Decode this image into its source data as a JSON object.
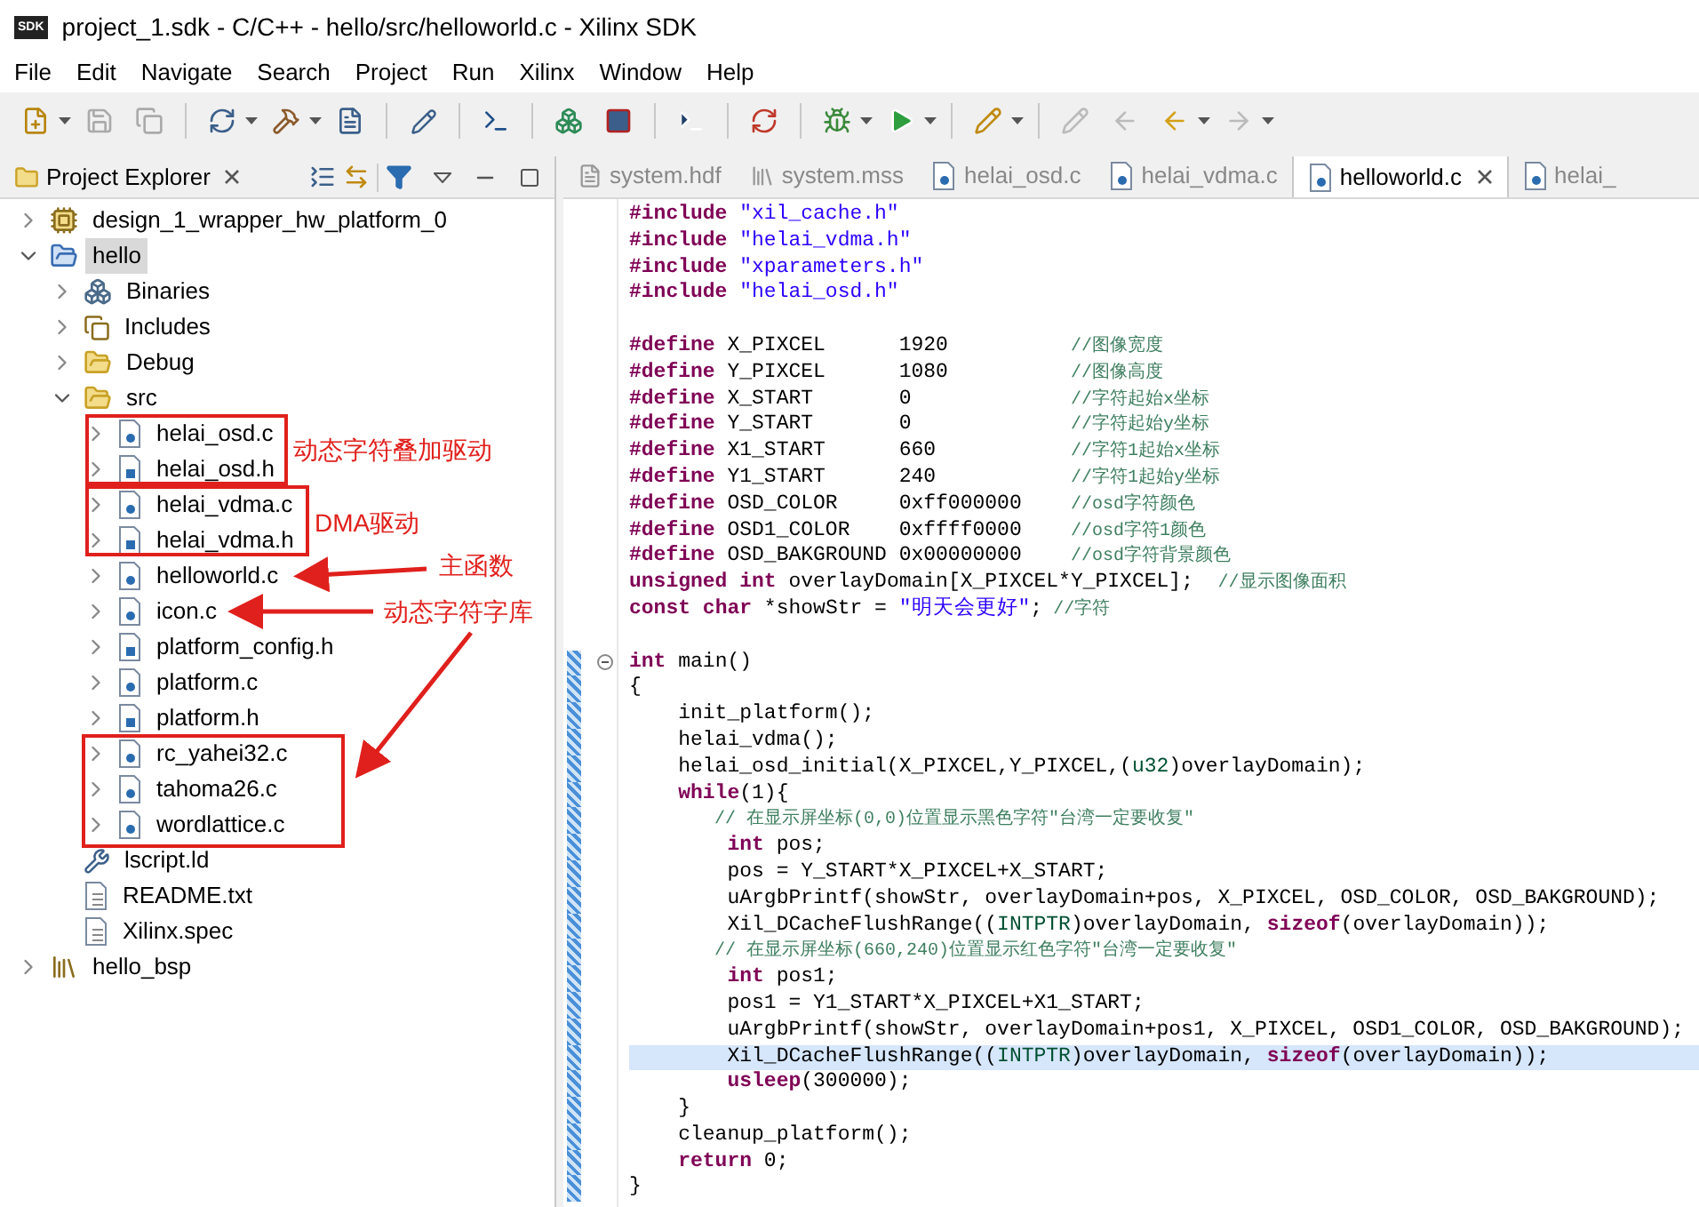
{
  "window": {
    "app_icon_text": "SDK",
    "title": "project_1.sdk - C/C++ - hello/src/helloworld.c - Xilinx SDK"
  },
  "menu": [
    "File",
    "Edit",
    "Navigate",
    "Search",
    "Project",
    "Run",
    "Xilinx",
    "Window",
    "Help"
  ],
  "project_explorer": {
    "title": "Project Explorer",
    "items": [
      {
        "label": "design_1_wrapper_hw_platform_0",
        "kind": "hw",
        "expanded": false,
        "selected": false
      },
      {
        "label": "hello",
        "kind": "project",
        "expanded": true,
        "selected": true,
        "children": [
          {
            "label": "Binaries",
            "kind": "binaries",
            "expanded": false,
            "selected": false
          },
          {
            "label": "Includes",
            "kind": "includes",
            "expanded": false,
            "selected": false
          },
          {
            "label": "Debug",
            "kind": "folder",
            "expanded": false,
            "selected": false
          },
          {
            "label": "src",
            "kind": "folder",
            "expanded": true,
            "selected": false,
            "children": [
              {
                "label": "helai_osd.c",
                "kind": "c",
                "expanded": false,
                "selected": false
              },
              {
                "label": "helai_osd.h",
                "kind": "h",
                "expanded": false,
                "selected": false
              },
              {
                "label": "helai_vdma.c",
                "kind": "c",
                "expanded": false,
                "selected": false
              },
              {
                "label": "helai_vdma.h",
                "kind": "h",
                "expanded": false,
                "selected": false
              },
              {
                "label": "helloworld.c",
                "kind": "c",
                "expanded": false,
                "selected": false
              },
              {
                "label": "icon.c",
                "kind": "c",
                "expanded": false,
                "selected": false
              },
              {
                "label": "platform_config.h",
                "kind": "h",
                "expanded": false,
                "selected": false
              },
              {
                "label": "platform.c",
                "kind": "c",
                "expanded": false,
                "selected": false
              },
              {
                "label": "platform.h",
                "kind": "h",
                "expanded": false,
                "selected": false
              },
              {
                "label": "rc_yahei32.c",
                "kind": "c",
                "expanded": false,
                "selected": false
              },
              {
                "label": "tahoma26.c",
                "kind": "c",
                "expanded": false,
                "selected": false
              },
              {
                "label": "wordlattice.c",
                "kind": "c",
                "expanded": false,
                "selected": false
              }
            ]
          },
          {
            "label": "lscript.ld",
            "kind": "ld",
            "selected": false
          },
          {
            "label": "README.txt",
            "kind": "txt",
            "selected": false
          },
          {
            "label": "Xilinx.spec",
            "kind": "txt",
            "selected": false
          }
        ]
      },
      {
        "label": "hello_bsp",
        "kind": "bsp",
        "expanded": false,
        "selected": false
      }
    ]
  },
  "annotations": [
    {
      "text": "动态字符叠加驱动"
    },
    {
      "text": "DMA驱动"
    },
    {
      "text": "主函数"
    },
    {
      "text": "动态字符字库"
    }
  ],
  "editor_tabs": [
    {
      "label": "system.hdf",
      "kind": "hdf",
      "selected": false
    },
    {
      "label": "system.mss",
      "kind": "mss",
      "selected": false
    },
    {
      "label": "helai_osd.c",
      "kind": "c",
      "selected": false
    },
    {
      "label": "helai_vdma.c",
      "kind": "c",
      "selected": false
    },
    {
      "label": "helloworld.c",
      "kind": "c",
      "selected": true
    },
    {
      "label": "helai_",
      "kind": "c",
      "selected": false
    }
  ],
  "code_lines": [
    {
      "changed": false,
      "current": false,
      "tokens": [
        {
          "kind": "keyword",
          "text": "#include"
        },
        {
          "kind": "string",
          "text": " \"xil_cache.h\""
        }
      ]
    },
    {
      "changed": false,
      "current": false,
      "tokens": [
        {
          "kind": "keyword",
          "text": "#include"
        },
        {
          "kind": "string",
          "text": " \"helai_vdma.h\""
        }
      ]
    },
    {
      "changed": false,
      "current": false,
      "tokens": [
        {
          "kind": "keyword",
          "text": "#include"
        },
        {
          "kind": "string",
          "text": " \"xparameters.h\""
        }
      ]
    },
    {
      "changed": false,
      "current": false,
      "tokens": [
        {
          "kind": "keyword",
          "text": "#include"
        },
        {
          "kind": "string",
          "text": " \"helai_osd.h\""
        }
      ]
    },
    {
      "changed": false,
      "current": false
    },
    {
      "changed": false,
      "current": false,
      "tokens": [
        {
          "kind": "keyword",
          "text": "#define"
        },
        {
          "kind": "plain",
          "text": " X_PIXCEL      1920          "
        },
        {
          "kind": "comment",
          "text": "//图像宽度"
        }
      ]
    },
    {
      "changed": false,
      "current": false,
      "tokens": [
        {
          "kind": "keyword",
          "text": "#define"
        },
        {
          "kind": "plain",
          "text": " Y_PIXCEL      1080          "
        },
        {
          "kind": "comment",
          "text": "//图像高度"
        }
      ]
    },
    {
      "changed": false,
      "current": false,
      "tokens": [
        {
          "kind": "keyword",
          "text": "#define"
        },
        {
          "kind": "plain",
          "text": " X_START       0             "
        },
        {
          "kind": "comment",
          "text": "//字符起始x坐标"
        }
      ]
    },
    {
      "changed": false,
      "current": false,
      "tokens": [
        {
          "kind": "keyword",
          "text": "#define"
        },
        {
          "kind": "plain",
          "text": " Y_START       0             "
        },
        {
          "kind": "comment",
          "text": "//字符起始y坐标"
        }
      ]
    },
    {
      "changed": false,
      "current": false,
      "tokens": [
        {
          "kind": "keyword",
          "text": "#define"
        },
        {
          "kind": "plain",
          "text": " X1_START      660           "
        },
        {
          "kind": "comment",
          "text": "//字符1起始x坐标"
        }
      ]
    },
    {
      "changed": false,
      "current": false,
      "tokens": [
        {
          "kind": "keyword",
          "text": "#define"
        },
        {
          "kind": "plain",
          "text": " Y1_START      240           "
        },
        {
          "kind": "comment",
          "text": "//字符1起始y坐标"
        }
      ]
    },
    {
      "changed": false,
      "current": false,
      "tokens": [
        {
          "kind": "keyword",
          "text": "#define"
        },
        {
          "kind": "plain",
          "text": " OSD_COLOR     0xff000000    "
        },
        {
          "kind": "comment",
          "text": "//osd字符颜色"
        }
      ]
    },
    {
      "changed": false,
      "current": false,
      "tokens": [
        {
          "kind": "keyword",
          "text": "#define"
        },
        {
          "kind": "plain",
          "text": " OSD1_COLOR    0xffff0000    "
        },
        {
          "kind": "comment",
          "text": "//osd字符1颜色"
        }
      ]
    },
    {
      "changed": false,
      "current": false,
      "tokens": [
        {
          "kind": "keyword",
          "text": "#define"
        },
        {
          "kind": "plain",
          "text": " OSD_BAKGROUND 0x00000000    "
        },
        {
          "kind": "comment",
          "text": "//osd字符背景颜色"
        }
      ]
    },
    {
      "changed": false,
      "current": false,
      "tokens": [
        {
          "kind": "keyword",
          "text": "unsigned"
        },
        {
          "kind": "keyword",
          "text": " int"
        },
        {
          "kind": "plain",
          "text": " overlayDomain[X_PIXCEL*Y_PIXCEL];  "
        },
        {
          "kind": "comment",
          "text": "//显示图像面积"
        }
      ]
    },
    {
      "changed": false,
      "current": false,
      "tokens": [
        {
          "kind": "keyword",
          "text": "const"
        },
        {
          "kind": "keyword",
          "text": " char"
        },
        {
          "kind": "plain",
          "text": " *showStr = "
        },
        {
          "kind": "string",
          "text": "\"明天会更好\""
        },
        {
          "kind": "plain",
          "text": ";"
        },
        {
          "kind": "comment",
          "text": " //字符"
        }
      ]
    },
    {
      "changed": false,
      "current": false
    },
    {
      "changed": true,
      "current": false,
      "fold": true,
      "tokens": [
        {
          "kind": "keyword",
          "text": "int"
        },
        {
          "kind": "plain",
          "text": " main()"
        }
      ]
    },
    {
      "changed": true,
      "current": false,
      "tokens": [
        {
          "kind": "plain",
          "text": "{"
        }
      ]
    },
    {
      "changed": true,
      "current": false,
      "tokens": [
        {
          "kind": "plain",
          "text": "    init_platform();"
        }
      ]
    },
    {
      "changed": true,
      "current": false,
      "tokens": [
        {
          "kind": "plain",
          "text": "    helai_vdma();"
        }
      ]
    },
    {
      "changed": true,
      "current": false,
      "tokens": [
        {
          "kind": "plain",
          "text": "    helai_osd_initial(X_PIXCEL,Y_PIXCEL,("
        },
        {
          "kind": "type",
          "text": "u32"
        },
        {
          "kind": "plain",
          "text": ")overlayDomain);"
        }
      ]
    },
    {
      "changed": true,
      "current": false,
      "tokens": [
        {
          "kind": "keyword",
          "text": "    while"
        },
        {
          "kind": "plain",
          "text": "(1){"
        }
      ]
    },
    {
      "changed": true,
      "current": false,
      "tokens": [
        {
          "kind": "comment",
          "text": "        // 在显示屏坐标(0,0)位置显示黑色字符\"台湾一定要收复\""
        }
      ]
    },
    {
      "changed": true,
      "current": false,
      "tokens": [
        {
          "kind": "keyword",
          "text": "        int"
        },
        {
          "kind": "plain",
          "text": " pos;"
        }
      ]
    },
    {
      "changed": true,
      "current": false,
      "tokens": [
        {
          "kind": "plain",
          "text": "        pos = Y_START*X_PIXCEL+X_START;"
        }
      ]
    },
    {
      "changed": true,
      "current": false,
      "tokens": [
        {
          "kind": "plain",
          "text": "        uArgbPrintf(showStr, overlayDomain+pos, X_PIXCEL, OSD_COLOR, OSD_BAKGROUND);"
        }
      ]
    },
    {
      "changed": true,
      "current": false,
      "tokens": [
        {
          "kind": "plain",
          "text": "        Xil_DCacheFlushRange(("
        },
        {
          "kind": "type",
          "text": "INTPTR"
        },
        {
          "kind": "plain",
          "text": ")overlayDomain, "
        },
        {
          "kind": "keyword",
          "text": "sizeof"
        },
        {
          "kind": "plain",
          "text": "(overlayDomain));"
        }
      ]
    },
    {
      "changed": true,
      "current": false,
      "tokens": [
        {
          "kind": "comment",
          "text": "        // 在显示屏坐标(660,240)位置显示红色字符\"台湾一定要收复\""
        }
      ]
    },
    {
      "changed": true,
      "current": false,
      "tokens": [
        {
          "kind": "keyword",
          "text": "        int"
        },
        {
          "kind": "plain",
          "text": " pos1;"
        }
      ]
    },
    {
      "changed": true,
      "current": false,
      "tokens": [
        {
          "kind": "plain",
          "text": "        pos1 = Y1_START*X_PIXCEL+X1_START;"
        }
      ]
    },
    {
      "changed": true,
      "current": false,
      "tokens": [
        {
          "kind": "plain",
          "text": "        uArgbPrintf(showStr, overlayDomain+pos1, X_PIXCEL, OSD1_COLOR, OSD_BAKGROUND);"
        }
      ]
    },
    {
      "changed": true,
      "current": true,
      "tokens": [
        {
          "kind": "plain",
          "text": "        Xil_DCacheFlushRange(("
        },
        {
          "kind": "type",
          "text": "INTPTR"
        },
        {
          "kind": "plain",
          "text": ")overlayDomain, "
        },
        {
          "kind": "keyword",
          "text": "sizeof"
        },
        {
          "kind": "plain",
          "text": "(overlayDomain));"
        }
      ]
    },
    {
      "changed": true,
      "current": false,
      "tokens": [
        {
          "kind": "keyword",
          "text": "        usleep"
        },
        {
          "kind": "plain",
          "text": "(300000);"
        }
      ]
    },
    {
      "changed": true,
      "current": false,
      "tokens": [
        {
          "kind": "plain",
          "text": "    }"
        }
      ]
    },
    {
      "changed": true,
      "current": false,
      "tokens": [
        {
          "kind": "plain",
          "text": "    cleanup_platform();"
        }
      ]
    },
    {
      "changed": true,
      "current": false,
      "tokens": [
        {
          "kind": "keyword",
          "text": "    return"
        },
        {
          "kind": "plain",
          "text": " 0;"
        }
      ]
    },
    {
      "changed": true,
      "current": false,
      "tokens": [
        {
          "kind": "plain",
          "text": "}"
        }
      ]
    }
  ]
}
